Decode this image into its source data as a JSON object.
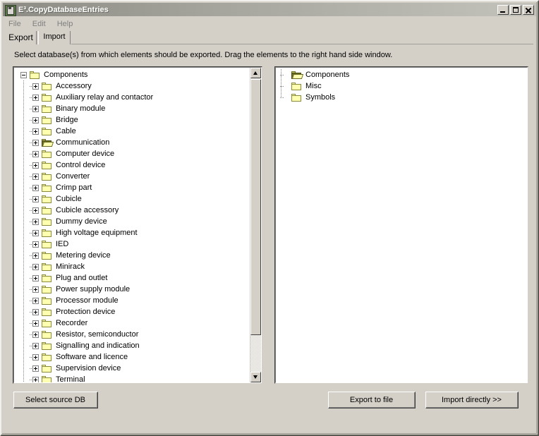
{
  "window": {
    "title": "E³.CopyDatabaseEntries",
    "icon": "app-icon",
    "controls": {
      "minimize": "Minimize",
      "maximize": "Maximize",
      "close": "Close"
    }
  },
  "menu": {
    "items": [
      {
        "label": "File"
      },
      {
        "label": "Edit"
      },
      {
        "label": "Help"
      }
    ]
  },
  "tabs": {
    "items": [
      {
        "label": "Export",
        "active": true
      },
      {
        "label": "Import",
        "active": false
      }
    ]
  },
  "instruction": "Select database(s) from which elements should be exported. Drag the elements to the right hand side window.",
  "left_tree": {
    "root": {
      "label": "Components",
      "expander": "minus",
      "icon": "folder-closed-icon"
    },
    "children": [
      {
        "label": "Accessory",
        "expander": "plus",
        "icon": "folder-closed-icon"
      },
      {
        "label": "Auxiliary relay and contactor",
        "expander": "plus",
        "icon": "folder-closed-icon"
      },
      {
        "label": "Binary module",
        "expander": "plus",
        "icon": "folder-closed-icon"
      },
      {
        "label": "Bridge",
        "expander": "plus",
        "icon": "folder-closed-icon"
      },
      {
        "label": "Cable",
        "expander": "plus",
        "icon": "folder-closed-icon"
      },
      {
        "label": "Communication",
        "expander": "plus",
        "icon": "folder-open-icon"
      },
      {
        "label": "Computer device",
        "expander": "plus",
        "icon": "folder-closed-icon"
      },
      {
        "label": "Control device",
        "expander": "plus",
        "icon": "folder-closed-icon"
      },
      {
        "label": "Converter",
        "expander": "plus",
        "icon": "folder-closed-icon"
      },
      {
        "label": "Crimp part",
        "expander": "plus",
        "icon": "folder-closed-icon"
      },
      {
        "label": "Cubicle",
        "expander": "plus",
        "icon": "folder-closed-icon"
      },
      {
        "label": "Cubicle accessory",
        "expander": "plus",
        "icon": "folder-closed-icon"
      },
      {
        "label": "Dummy device",
        "expander": "plus",
        "icon": "folder-closed-icon"
      },
      {
        "label": "High voltage equipment",
        "expander": "plus",
        "icon": "folder-closed-icon"
      },
      {
        "label": "IED",
        "expander": "plus",
        "icon": "folder-closed-icon"
      },
      {
        "label": "Metering device",
        "expander": "plus",
        "icon": "folder-closed-icon"
      },
      {
        "label": "Minirack",
        "expander": "plus",
        "icon": "folder-closed-icon"
      },
      {
        "label": "Plug and outlet",
        "expander": "plus",
        "icon": "folder-closed-icon"
      },
      {
        "label": "Power supply module",
        "expander": "plus",
        "icon": "folder-closed-icon"
      },
      {
        "label": "Processor module",
        "expander": "plus",
        "icon": "folder-closed-icon"
      },
      {
        "label": "Protection device",
        "expander": "plus",
        "icon": "folder-closed-icon"
      },
      {
        "label": "Recorder",
        "expander": "plus",
        "icon": "folder-closed-icon"
      },
      {
        "label": "Resistor, semiconductor",
        "expander": "plus",
        "icon": "folder-closed-icon"
      },
      {
        "label": "Signalling and indication",
        "expander": "plus",
        "icon": "folder-closed-icon"
      },
      {
        "label": "Software and licence",
        "expander": "plus",
        "icon": "folder-closed-icon"
      },
      {
        "label": "Supervision device",
        "expander": "plus",
        "icon": "folder-closed-icon"
      },
      {
        "label": "Terminal",
        "expander": "plus",
        "icon": "folder-closed-icon"
      }
    ]
  },
  "right_tree": {
    "items": [
      {
        "label": "Components",
        "icon": "folder-open-icon"
      },
      {
        "label": "Misc",
        "icon": "folder-closed-icon"
      },
      {
        "label": "Symbols",
        "icon": "folder-closed-icon"
      }
    ]
  },
  "scrollbar": {
    "up_arrow": "scroll-up-icon",
    "down_arrow": "scroll-down-icon",
    "thumb_position_percent": 0,
    "thumb_size_percent": 84
  },
  "buttons": {
    "select_source_db": "Select source DB",
    "export_to_file": "Export to file",
    "import_directly": "Import directly >>"
  },
  "colors": {
    "window_face": "#d4d0c8",
    "panel_background": "#ffffff",
    "folder_yellow": "#ffffb0",
    "folder_outline": "#8a8a3c",
    "folder_open_dark": "#6e6e20",
    "menu_disabled_text": "#808080",
    "title_text": "#ffffff"
  }
}
